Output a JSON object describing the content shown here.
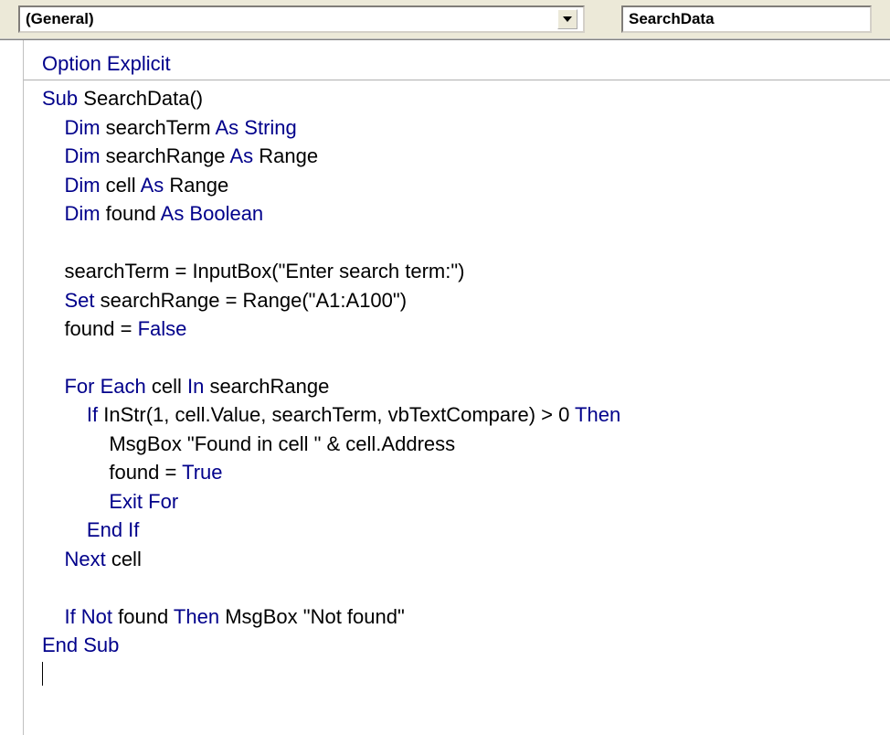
{
  "toolbar": {
    "object_dropdown": "(General)",
    "proc_dropdown": "SearchData"
  },
  "code": {
    "tokens": [
      [
        {
          "t": "Option Explicit",
          "k": true
        }
      ],
      "HR",
      [
        {
          "t": "Sub",
          "k": true
        },
        {
          "t": " SearchData()"
        }
      ],
      [
        {
          "t": "    "
        },
        {
          "t": "Dim",
          "k": true
        },
        {
          "t": " searchTerm "
        },
        {
          "t": "As String",
          "k": true
        }
      ],
      [
        {
          "t": "    "
        },
        {
          "t": "Dim",
          "k": true
        },
        {
          "t": " searchRange "
        },
        {
          "t": "As",
          "k": true
        },
        {
          "t": " Range"
        }
      ],
      [
        {
          "t": "    "
        },
        {
          "t": "Dim",
          "k": true
        },
        {
          "t": " cell "
        },
        {
          "t": "As",
          "k": true
        },
        {
          "t": " Range"
        }
      ],
      [
        {
          "t": "    "
        },
        {
          "t": "Dim",
          "k": true
        },
        {
          "t": " found "
        },
        {
          "t": "As Boolean",
          "k": true
        }
      ],
      [
        {
          "t": "    "
        }
      ],
      [
        {
          "t": "    searchTerm = InputBox(\"Enter search term:\")"
        }
      ],
      [
        {
          "t": "    "
        },
        {
          "t": "Set",
          "k": true
        },
        {
          "t": " searchRange = Range(\"A1:A100\")"
        }
      ],
      [
        {
          "t": "    found = "
        },
        {
          "t": "False",
          "k": true
        }
      ],
      [
        {
          "t": "    "
        }
      ],
      [
        {
          "t": "    "
        },
        {
          "t": "For Each",
          "k": true
        },
        {
          "t": " cell "
        },
        {
          "t": "In",
          "k": true
        },
        {
          "t": " searchRange"
        }
      ],
      [
        {
          "t": "        "
        },
        {
          "t": "If",
          "k": true
        },
        {
          "t": " InStr(1, cell.Value, searchTerm, vbTextCompare) > 0 "
        },
        {
          "t": "Then",
          "k": true
        }
      ],
      [
        {
          "t": "            MsgBox \"Found in cell \" & cell.Address"
        }
      ],
      [
        {
          "t": "            found = "
        },
        {
          "t": "True",
          "k": true
        }
      ],
      [
        {
          "t": "            "
        },
        {
          "t": "Exit For",
          "k": true
        }
      ],
      [
        {
          "t": "        "
        },
        {
          "t": "End If",
          "k": true
        }
      ],
      [
        {
          "t": "    "
        },
        {
          "t": "Next",
          "k": true
        },
        {
          "t": " cell"
        }
      ],
      [
        {
          "t": "    "
        }
      ],
      [
        {
          "t": "    "
        },
        {
          "t": "If Not",
          "k": true
        },
        {
          "t": " found "
        },
        {
          "t": "Then",
          "k": true
        },
        {
          "t": " MsgBox \"Not found\""
        }
      ],
      [
        {
          "t": "End Sub",
          "k": true
        }
      ],
      "CURSOR"
    ]
  }
}
